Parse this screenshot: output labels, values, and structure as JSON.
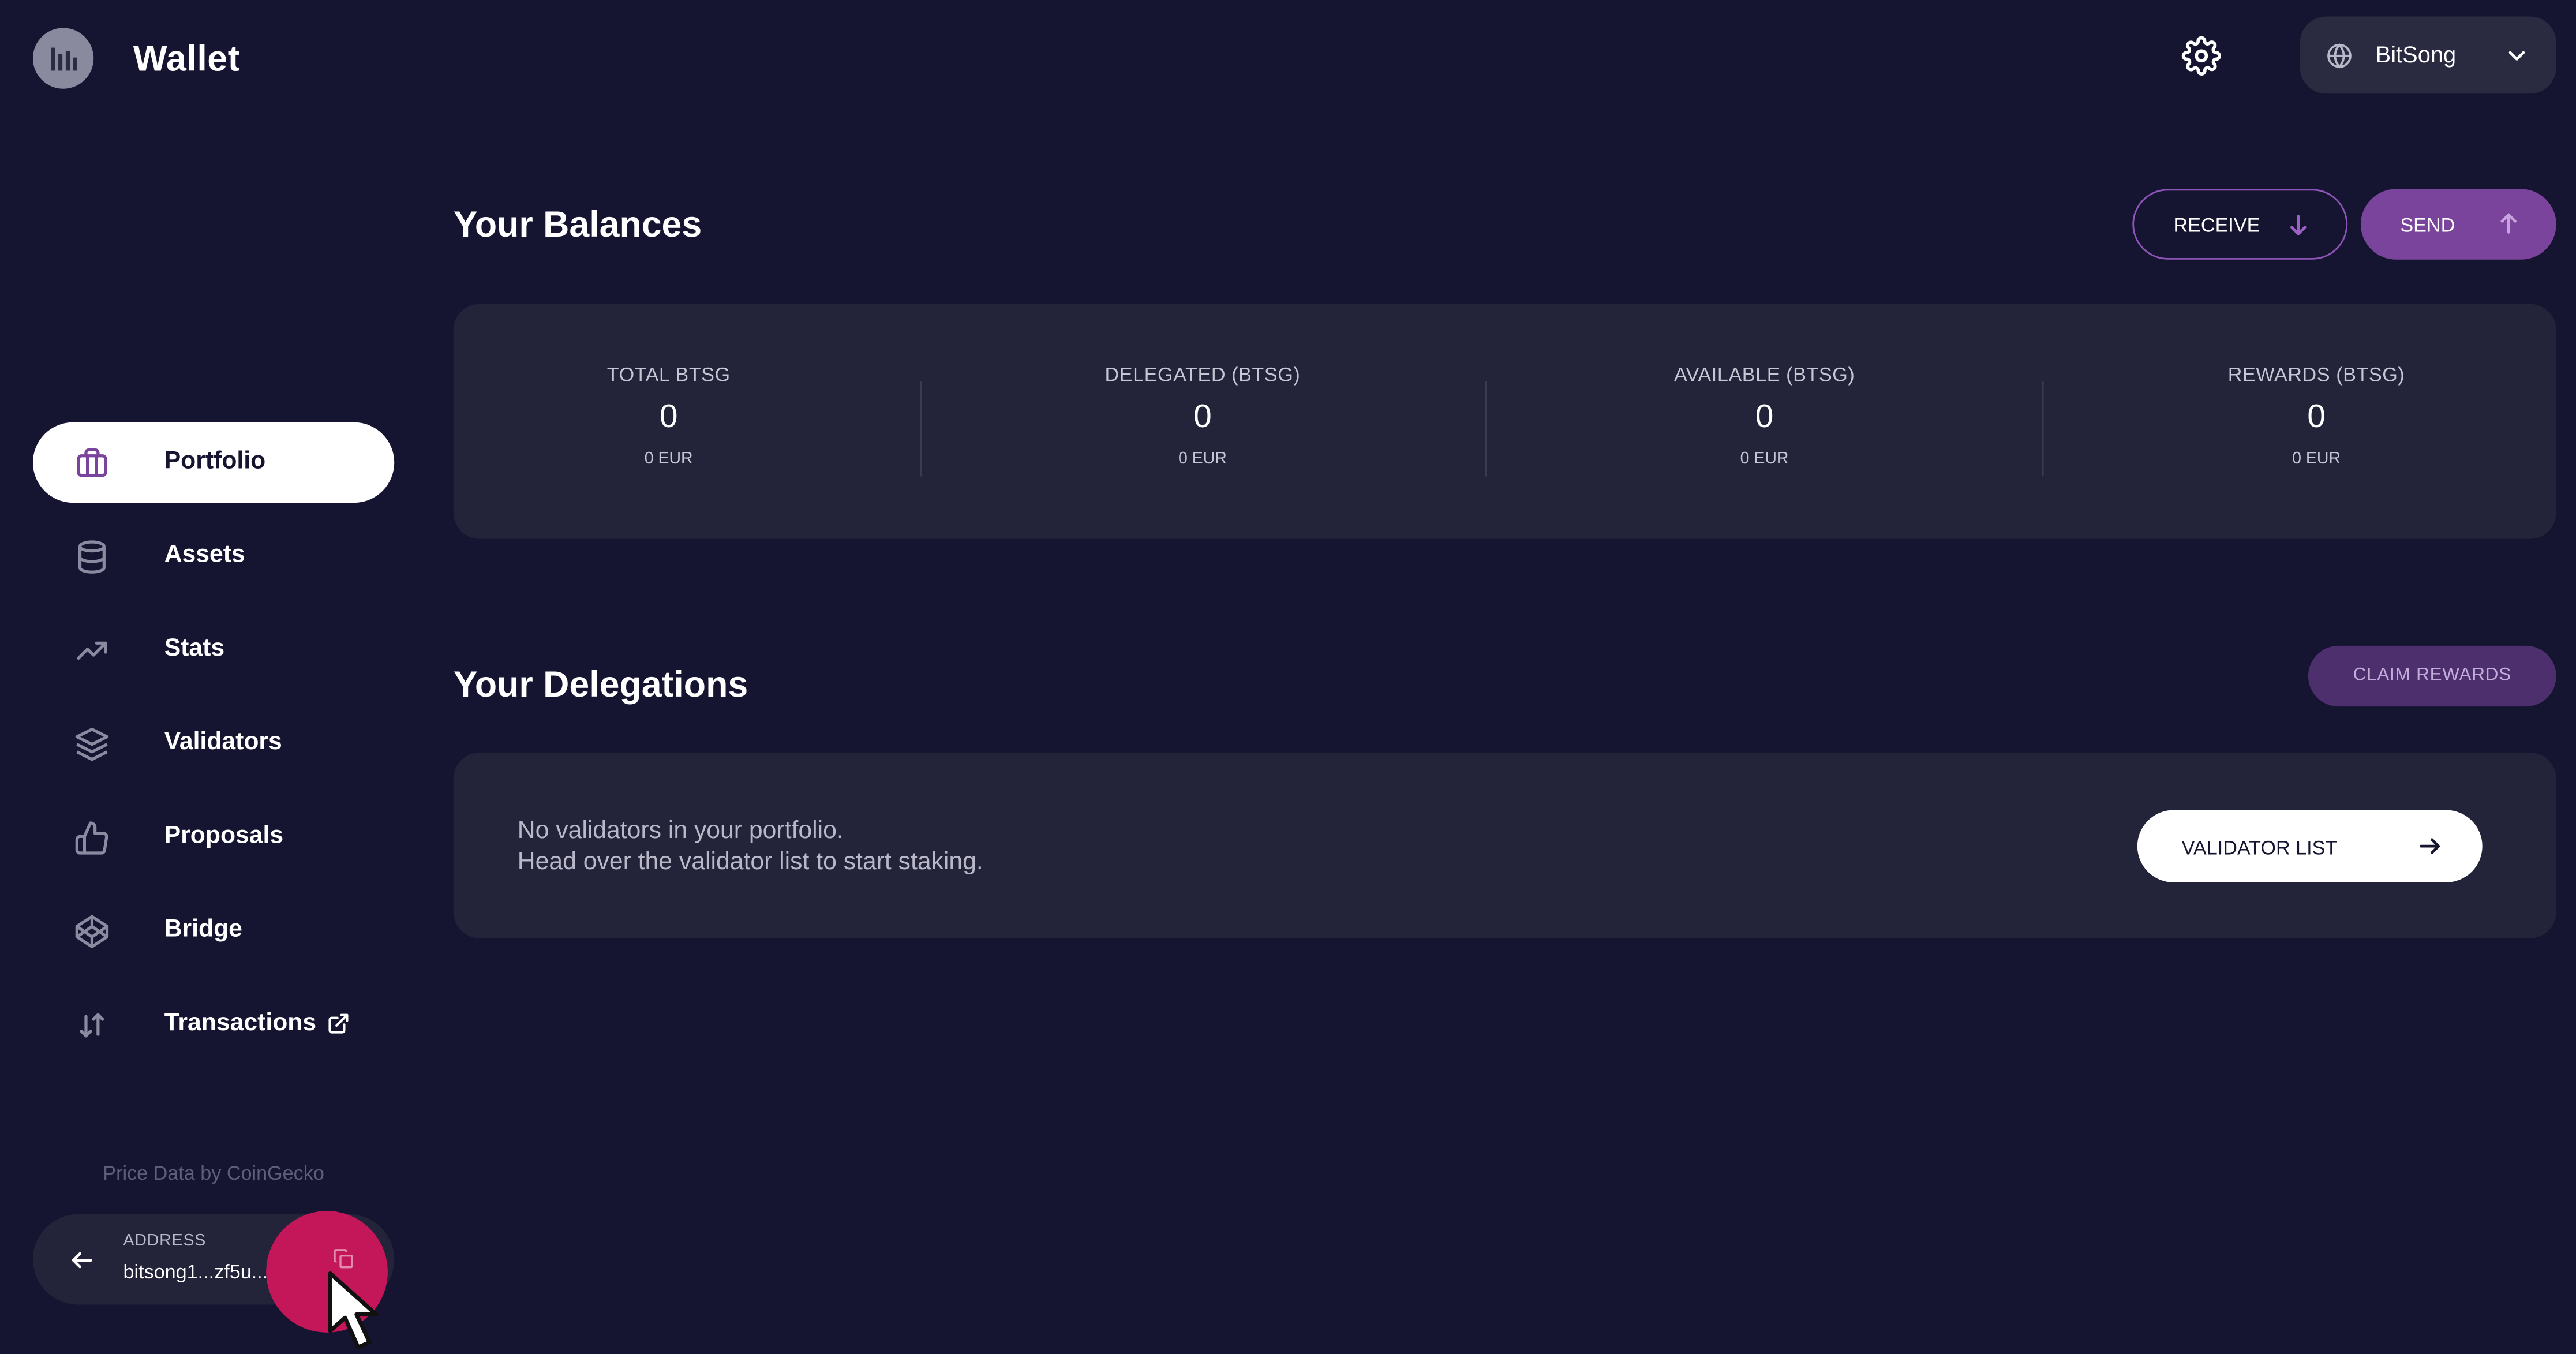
{
  "header": {
    "app_title": "Wallet",
    "network": "BitSong",
    "icons": {
      "logo": "bitsong-logo",
      "settings": "gear-icon",
      "network": "globe-icon",
      "dropdown": "chevron-down-icon"
    }
  },
  "sidebar": {
    "items": [
      {
        "label": "Portfolio",
        "icon": "briefcase-icon",
        "active": true
      },
      {
        "label": "Assets",
        "icon": "database-icon"
      },
      {
        "label": "Stats",
        "icon": "trending-up-icon"
      },
      {
        "label": "Validators",
        "icon": "layers-icon"
      },
      {
        "label": "Proposals",
        "icon": "thumbs-up-icon"
      },
      {
        "label": "Bridge",
        "icon": "bridge-icon"
      },
      {
        "label": "Transactions",
        "icon": "arrows-up-down-icon",
        "external": true
      }
    ],
    "price_credit": "Price Data by CoinGecko",
    "address": {
      "caption": "ADDRESS",
      "value": "bitsong1...zf5u..."
    }
  },
  "balances": {
    "title": "Your Balances",
    "receive_label": "RECEIVE",
    "send_label": "SEND",
    "stats": [
      {
        "caption": "TOTAL BTSG",
        "value": "0",
        "fiat": "0 EUR"
      },
      {
        "caption": "DELEGATED (BTSG)",
        "value": "0",
        "fiat": "0 EUR"
      },
      {
        "caption": "AVAILABLE (BTSG)",
        "value": "0",
        "fiat": "0 EUR"
      },
      {
        "caption": "REWARDS (BTSG)",
        "value": "0",
        "fiat": "0 EUR"
      }
    ]
  },
  "delegations": {
    "title": "Your Delegations",
    "claim_label": "CLAIM REWARDS",
    "empty_line1": "No validators in your portfolio.",
    "empty_line2": "Head over the validator list to start staking.",
    "validator_list_label": "VALIDATOR LIST"
  },
  "colors": {
    "background": "#151531",
    "card": "#232339",
    "accent": "#7b449c",
    "copy_button": "#c4175a"
  }
}
